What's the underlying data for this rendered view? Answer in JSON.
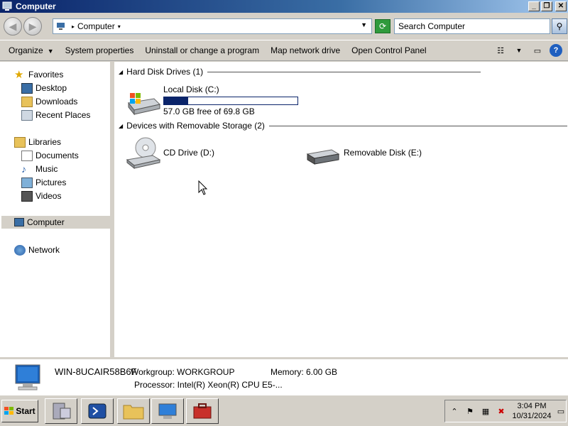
{
  "window": {
    "title": "Computer",
    "min_label": "_",
    "max_label": "❐",
    "close_label": "✕"
  },
  "address": {
    "crumb": "Computer",
    "search_placeholder": "Search Computer"
  },
  "commands": {
    "organize": "Organize",
    "system_properties": "System properties",
    "uninstall": "Uninstall or change a program",
    "map_drive": "Map network drive",
    "control_panel": "Open Control Panel"
  },
  "nav": {
    "favorites": "Favorites",
    "desktop": "Desktop",
    "downloads": "Downloads",
    "recent": "Recent Places",
    "libraries": "Libraries",
    "documents": "Documents",
    "music": "Music",
    "pictures": "Pictures",
    "videos": "Videos",
    "computer": "Computer",
    "network": "Network"
  },
  "groups": {
    "hdd": "Hard Disk Drives (1)",
    "removable": "Devices with Removable Storage (2)"
  },
  "drives": {
    "c": {
      "name": "Local Disk (C:)",
      "free_text": "57.0 GB free of 69.8 GB",
      "used_fraction": 0.183
    },
    "d": {
      "name": "CD Drive (D:)"
    },
    "e": {
      "name": "Removable Disk (E:)"
    }
  },
  "details": {
    "computer_name": "WIN-8UCAIR58B6F",
    "workgroup": "Workgroup: WORKGROUP",
    "memory": "Memory: 6.00 GB",
    "processor": "Processor: Intel(R) Xeon(R) CPU E5-..."
  },
  "taskbar": {
    "start": "Start",
    "time": "3:04 PM",
    "date": "10/31/2024"
  },
  "colors": {
    "accent": "#0a246a",
    "chrome": "#d4d0c8"
  }
}
